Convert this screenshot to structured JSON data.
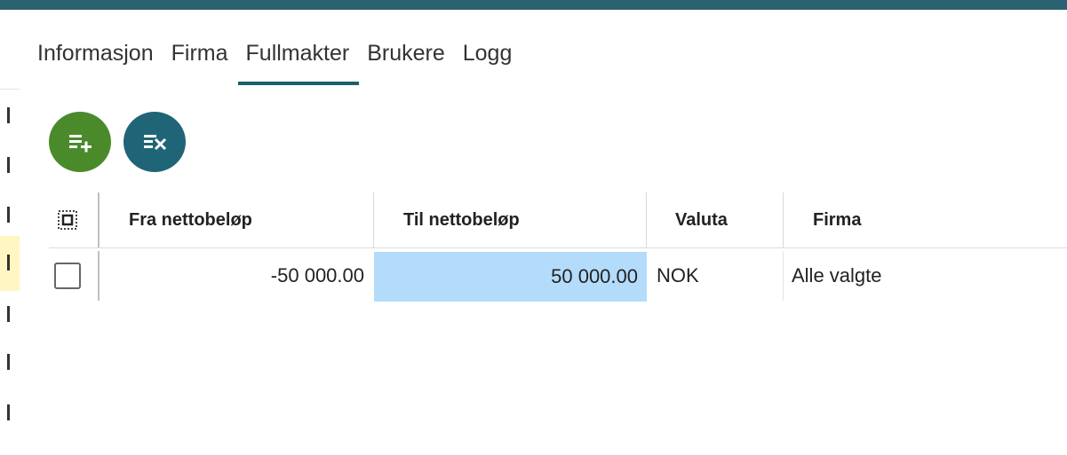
{
  "tabs": [
    {
      "label": "Informasjon",
      "active": false
    },
    {
      "label": "Firma",
      "active": false
    },
    {
      "label": "Fullmakter",
      "active": true
    },
    {
      "label": "Brukere",
      "active": false
    },
    {
      "label": "Logg",
      "active": false
    }
  ],
  "toolbar": {
    "add_icon": "add-list-icon",
    "remove_icon": "remove-list-icon",
    "add_color": "#4a8a2b",
    "remove_color": "#1f6577"
  },
  "table": {
    "columns": [
      "Fra nettobeløp",
      "Til nettobeløp",
      "Valuta",
      "Firma"
    ],
    "rows": [
      {
        "fra": "-50 000.00",
        "til": "50 000.00",
        "valuta": "NOK",
        "firma": "Alle valgte"
      }
    ]
  },
  "colors": {
    "accent": "#1e5d6e",
    "selected_cell": "#b3dcfb"
  }
}
